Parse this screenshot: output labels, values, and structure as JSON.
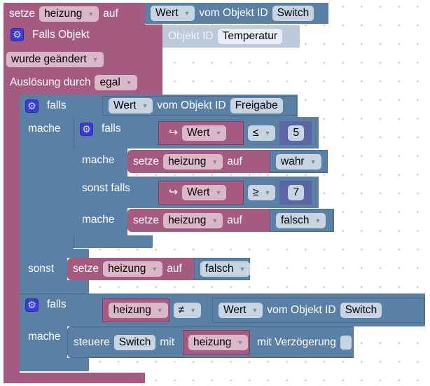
{
  "colors": {
    "logic": "#5b80a5",
    "variable": "#a55b80",
    "math": "#5b67a5",
    "event": "#a55b80"
  },
  "top_set": {
    "keyword": "setze",
    "variable": "heizung",
    "to": "auf",
    "value": {
      "attr": "Wert",
      "of": "vom Objekt ID",
      "id": "Switch"
    }
  },
  "event": {
    "icon": "gear-icon",
    "title": "Falls Objekt",
    "object_label": "Objekt ID",
    "object_id": "Temperatur",
    "condition": "wurde geändert",
    "trigger_label": "Auslösung durch",
    "trigger": "egal"
  },
  "if1": {
    "if_label": "falls",
    "do_label": "mache",
    "else_label": "sonst",
    "condition": {
      "attr": "Wert",
      "of": "vom Objekt ID",
      "id": "Freigabe"
    },
    "inner": {
      "if_label": "falls",
      "do_label": "mache",
      "elseif_label": "sonst falls",
      "cond1": {
        "arrow": "↪",
        "var": "Wert",
        "op": "≤",
        "num": "5"
      },
      "do1": {
        "keyword": "setze",
        "variable": "heizung",
        "to": "auf",
        "value": "wahr"
      },
      "cond2": {
        "arrow": "↪",
        "var": "Wert",
        "op": "≥",
        "num": "7"
      },
      "do2": {
        "keyword": "setze",
        "variable": "heizung",
        "to": "auf",
        "value": "falsch"
      }
    },
    "else_do": {
      "keyword": "setze",
      "variable": "heizung",
      "to": "auf",
      "value": "falsch"
    }
  },
  "if2": {
    "if_label": "falls",
    "do_label": "mache",
    "condition": {
      "var": "heizung",
      "op": "≠",
      "attr": "Wert",
      "of": "vom Objekt ID",
      "id": "Switch"
    },
    "do": {
      "keyword": "steuere",
      "id": "Switch",
      "with": "mit",
      "var": "heizung",
      "delay_label": "mit Verzögerung",
      "delay_checked": false
    }
  }
}
